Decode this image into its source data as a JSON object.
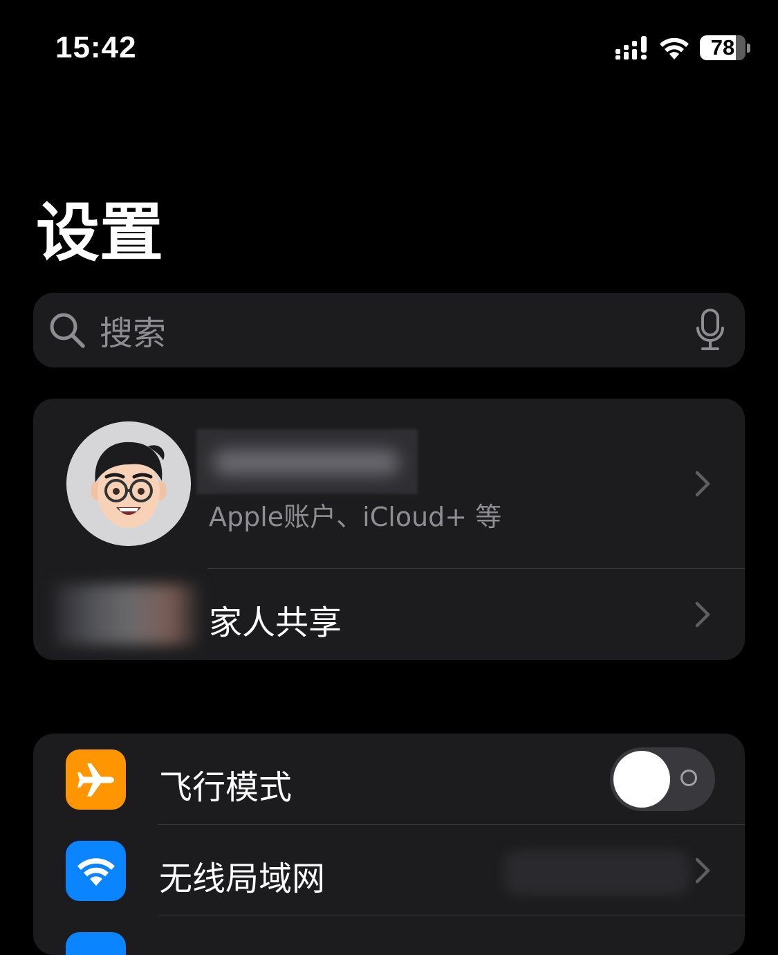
{
  "status_bar": {
    "time": "15:42",
    "battery_level": "78",
    "icons": [
      "cellular-signal-icon",
      "wifi-icon",
      "battery-icon"
    ]
  },
  "title": "设置",
  "search": {
    "placeholder": "搜索",
    "icons": [
      "search-icon",
      "microphone-icon"
    ]
  },
  "account": {
    "subtitle": "Apple账户、iCloud+ 等",
    "family_label": "家人共享"
  },
  "settings": [
    {
      "label": "飞行模式",
      "icon": "airplane-icon",
      "icon_color": "#ff9500",
      "toggle_on": false
    },
    {
      "label": "无线局域网",
      "icon": "wifi-icon",
      "icon_color": "#0a84ff"
    }
  ],
  "colors": {
    "background": "#000000",
    "card": "#1c1c1e",
    "secondary_text": "#8d8d93",
    "separator": "#38383a"
  }
}
